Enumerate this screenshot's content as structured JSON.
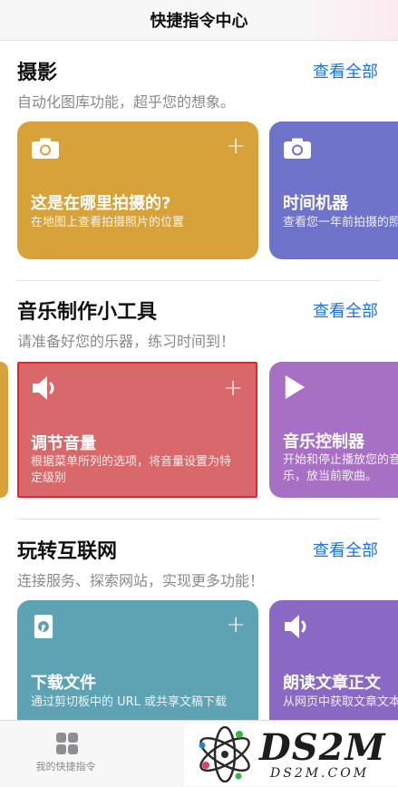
{
  "header": {
    "title": "快捷指令中心"
  },
  "colors": {
    "link": "#1a73e8",
    "card_yellow": "#d8a23a",
    "card_indigo": "#6e73c9",
    "card_red": "#d9686b",
    "card_purple": "#a770c4",
    "card_teal": "#5ea3b3",
    "highlight": "#e8232a"
  },
  "sections": [
    {
      "title": "摄影",
      "see_all": "查看全部",
      "subtitle": "自动化图库功能，超乎您的想象。",
      "cards": [
        {
          "icon": "camera-icon",
          "title": "这是在哪里拍摄的?",
          "desc": "在地图上查看拍摄照片的位置",
          "add": "+"
        },
        {
          "icon": "camera-icon",
          "title": "时间机器",
          "desc": "查看您一年前拍摄的照片"
        }
      ]
    },
    {
      "title": "音乐制作小工具",
      "see_all": "查看全部",
      "subtitle": "请准备好您的乐器，练习时间到！",
      "cards": [
        {
          "icon": "speaker-icon",
          "title": "调节音量",
          "desc": "根据菜单所列的选项，将音量设置为特定级别",
          "add": "+"
        },
        {
          "icon": "play-icon",
          "title": "音乐控制器",
          "desc": "开始和停止播放您的音乐，放当前歌曲。"
        }
      ]
    },
    {
      "title": "玩转互联网",
      "see_all": "查看全部",
      "subtitle": "连接服务、探索网站，实现更多功能！",
      "cards": [
        {
          "icon": "download-file-icon",
          "title": "下载文件",
          "desc": "通过剪切板中的 URL 或共享文稿下载",
          "add": "+"
        },
        {
          "icon": "speaker-icon",
          "title": "朗读文章正文",
          "desc": "从网页中获取文章文本"
        }
      ]
    }
  ],
  "tabbar": {
    "items": [
      {
        "icon": "grid-icon",
        "label": "我的快捷指令"
      }
    ]
  },
  "watermark": {
    "text": "DS2M",
    "sub": "DS2M.COM"
  }
}
